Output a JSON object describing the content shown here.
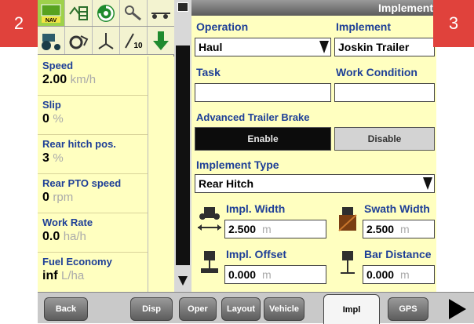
{
  "badges": {
    "left": "2",
    "right": "3"
  },
  "header": {
    "title": "Implement"
  },
  "left_icons": {
    "row1": [
      "nav-icon",
      "grid-icon",
      "circle-swirl-icon",
      "tool-icon",
      "rake-icon"
    ],
    "row2": [
      "tractor-icon",
      "wheel-icon",
      "sprayer-icon",
      "pto-10-icon",
      "down-arrow-icon"
    ],
    "nav_badge": "NAV",
    "pto_badge": "10"
  },
  "readouts": [
    {
      "label": "Speed",
      "value": "2.00",
      "unit": "km/h"
    },
    {
      "label": "Slip",
      "value": "0",
      "unit": "%"
    },
    {
      "label": "Rear hitch pos.",
      "value": "3",
      "unit": "%"
    },
    {
      "label": "Rear PTO speed",
      "value": "0",
      "unit": "rpm"
    },
    {
      "label": "Work Rate",
      "value": "0.0",
      "unit": "ha/h"
    },
    {
      "label": "Fuel Economy",
      "value": "inf",
      "unit": "L/ha"
    }
  ],
  "form": {
    "operation_label": "Operation",
    "operation_value": "Haul",
    "implement_label": "Implement",
    "implement_value": "Joskin Trailer",
    "task_label": "Task",
    "task_value": "",
    "work_condition_label": "Work Condition",
    "work_condition_value": "",
    "trailer_brake_label": "Advanced Trailer Brake",
    "enable_label": "Enable",
    "disable_label": "Disable",
    "implement_type_label": "Implement Type",
    "implement_type_value": "Rear Hitch",
    "impl_width_label": "Impl. Width",
    "impl_width_value": "2.500",
    "impl_width_unit": "m",
    "swath_width_label": "Swath Width",
    "swath_width_value": "2.500",
    "swath_width_unit": "m",
    "impl_offset_label": "Impl. Offset",
    "impl_offset_value": "0.000",
    "impl_offset_unit": "m",
    "bar_distance_label": "Bar Distance",
    "bar_distance_value": "0.000",
    "bar_distance_unit": "m"
  },
  "tabs": {
    "back": "Back",
    "disp": "Disp",
    "oper": "Oper",
    "layout": "Layout",
    "vehicle": "Vehicle",
    "impl": "Impl",
    "gps": "GPS"
  },
  "colors": {
    "panel_bg": "#ffffc0",
    "label_blue": "#1e3f97",
    "enable_bg": "#0c0c0c",
    "disable_bg": "#d3d3d3",
    "badge_red": "#e0423c"
  }
}
